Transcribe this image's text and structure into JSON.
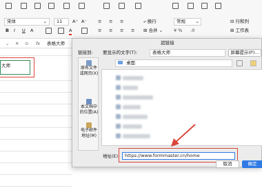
{
  "toolbar": {
    "font_name": "宋体",
    "font_size": "11",
    "wrap_label": "换行",
    "merge_label": "合并",
    "number_format": "常规",
    "rows_cols_label": "行和列",
    "worksheet_label": "工作表"
  },
  "formula_bar": {
    "fx_label": "fx",
    "content": "表格大师"
  },
  "sheet": {
    "cell_text": "大师"
  },
  "dialog": {
    "title": "超链接",
    "link_to_label": "链接到:",
    "display_text_label": "要显示的文字(T):",
    "display_text_value": "表格大师",
    "screen_tip_button": "屏幕提示(P)...",
    "places": [
      {
        "label": "原有文件\n或网页(X)"
      },
      {
        "label": "本文档中\n的位置(A)"
      },
      {
        "label": "电子邮件\n地址(M)"
      }
    ],
    "folder": "桌面",
    "address_label": "地址(E):",
    "address_value": "https://www.formmaster.cn/home",
    "cancel_button": "取消",
    "ok_button": "确定"
  },
  "colors": {
    "highlight": "#d9453a",
    "accent": "#2f7ae5",
    "cell_border": "#2e8b57"
  }
}
